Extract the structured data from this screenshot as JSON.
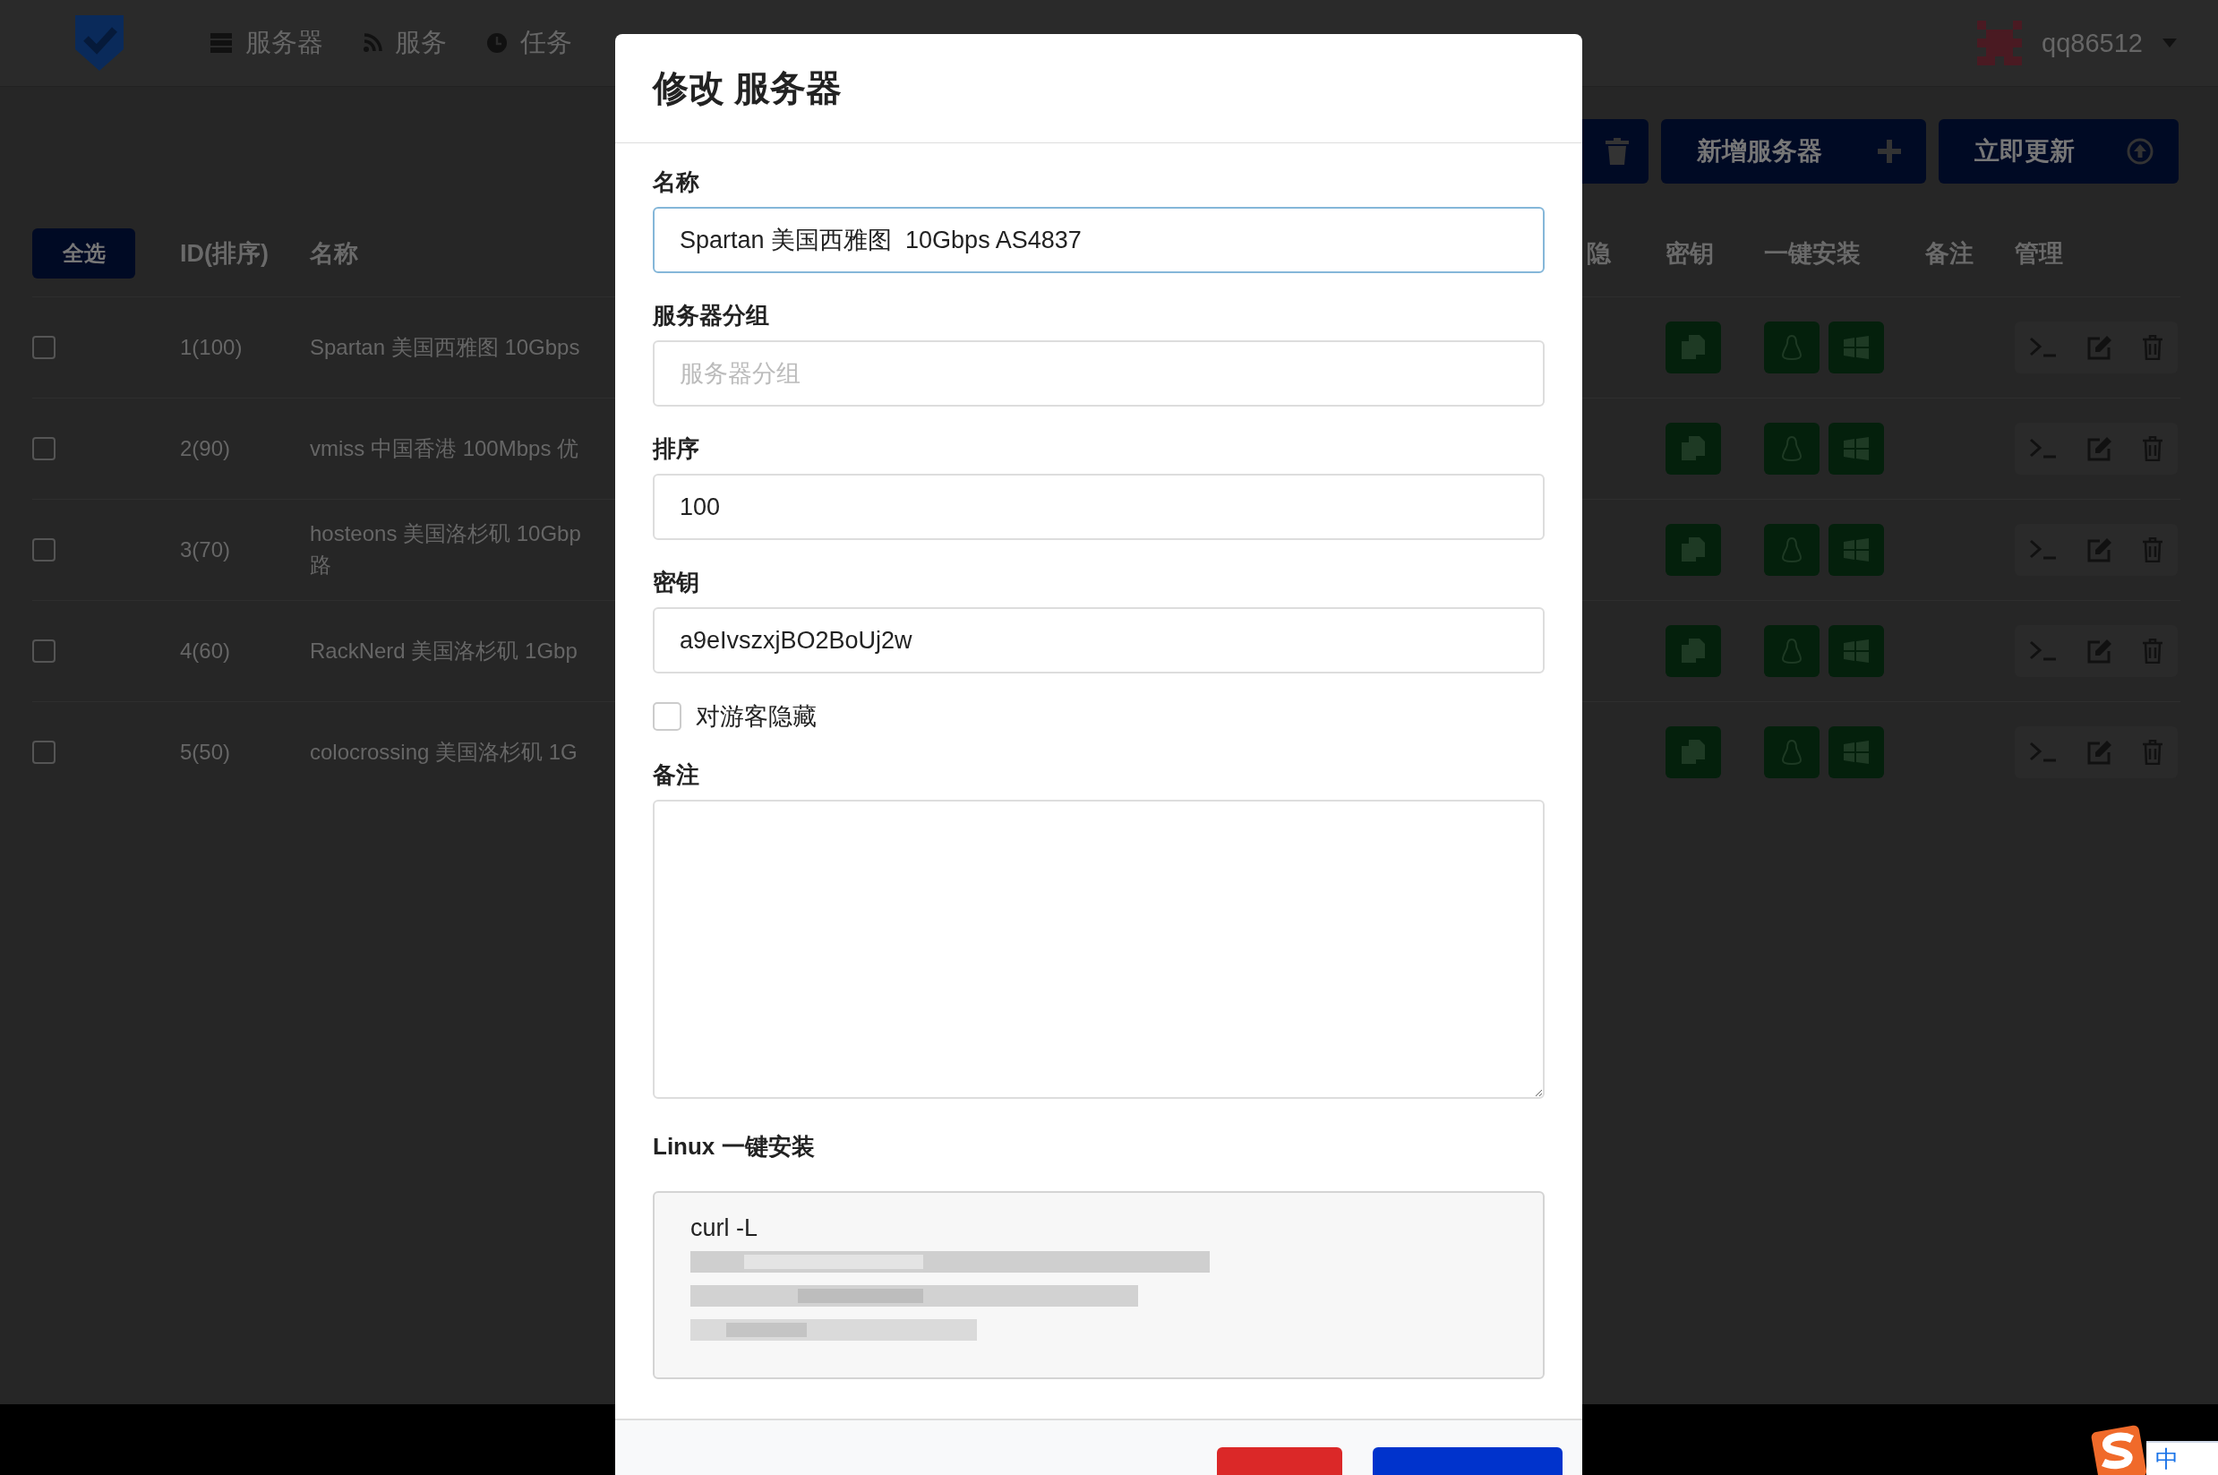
{
  "nav": {
    "items": [
      {
        "label": "服务器"
      },
      {
        "label": "服务"
      },
      {
        "label": "任务"
      }
    ],
    "user": {
      "name": "qq86512"
    }
  },
  "toolbar": {
    "buttons": [
      {
        "kind": "delete"
      },
      {
        "kind": "add",
        "label": "新增服务器"
      },
      {
        "kind": "update",
        "label": "立即更新"
      }
    ]
  },
  "table": {
    "select_all": "全选",
    "columns_left": [
      "ID(排序)",
      "名称"
    ],
    "columns_right": [
      "隐",
      "密钥",
      "一键安装",
      "备注",
      "管理"
    ],
    "rows": [
      {
        "checked": false,
        "id": "1(100)",
        "name": [
          "Spartan 美国西雅图 10Gbps"
        ]
      },
      {
        "checked": false,
        "id": "2(90)",
        "name": [
          "vmiss 中国香港 100Mbps 优"
        ]
      },
      {
        "checked": false,
        "id": "3(70)",
        "name": [
          "hosteons 美国洛杉矶 10Gbp",
          "路"
        ]
      },
      {
        "checked": false,
        "id": "4(60)",
        "name": [
          "RackNerd 美国洛杉矶 1Gbp"
        ]
      },
      {
        "checked": false,
        "id": "5(50)",
        "name": [
          "colocrossing 美国洛杉矶 1G"
        ]
      }
    ]
  },
  "modal": {
    "title": "修改 服务器",
    "fields": [
      {
        "kind": "input",
        "label": "名称",
        "value": "Spartan 美国西雅图  10Gbps AS4837",
        "focused": true
      },
      {
        "kind": "input",
        "label": "服务器分组",
        "placeholder": "服务器分组",
        "focused": false
      },
      {
        "kind": "input",
        "label": "排序",
        "value": "100",
        "focused": false
      },
      {
        "kind": "input",
        "label": "密钥",
        "value": "a9eIvszxjBO2BoUj2w",
        "focused": false
      },
      {
        "kind": "checkbox",
        "label": "对游客隐藏",
        "checked": false
      },
      {
        "kind": "textarea",
        "label": "备注"
      },
      {
        "kind": "code",
        "label": "Linux 一键安装",
        "value": "curl -L"
      }
    ],
    "footer_buttons": [
      {
        "kind": "cancel"
      },
      {
        "kind": "confirm"
      }
    ]
  },
  "ime": {
    "mode": "中"
  }
}
